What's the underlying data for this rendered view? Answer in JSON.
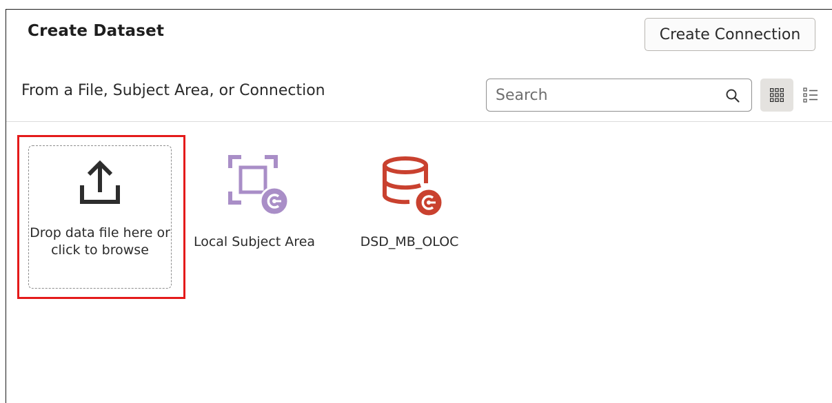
{
  "dialog": {
    "title": "Create Dataset",
    "create_connection_label": "Create Connection",
    "subtitle": "From a File, Subject Area, or Connection"
  },
  "search": {
    "placeholder": "Search",
    "value": "",
    "icon": "search-icon"
  },
  "view_toggle": {
    "grid_icon": "grid-view-icon",
    "list_icon": "list-view-icon",
    "selected": "grid"
  },
  "sources": {
    "drop_zone": {
      "label": "Drop data file here or click to browse",
      "icon": "upload-icon"
    },
    "items": [
      {
        "label": "Local Subject Area",
        "icon": "subject-area-icon",
        "color": "#a98ec7"
      },
      {
        "label": "DSD_MB_OLOC",
        "icon": "database-connection-icon",
        "color": "#c9412f"
      }
    ]
  },
  "colors": {
    "highlight": "#e41a1a",
    "subject_area": "#a98ec7",
    "database": "#c9412f",
    "icon_dark": "#2d2d2d"
  }
}
